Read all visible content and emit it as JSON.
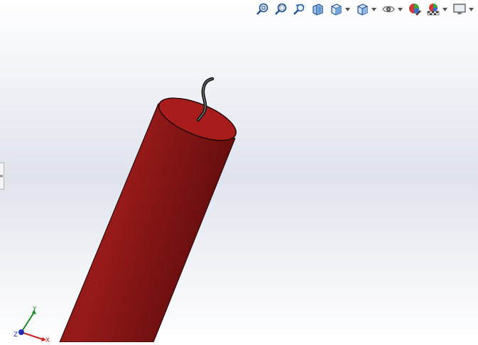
{
  "toolbar": {
    "buttons": [
      {
        "name": "zoom-to-fit",
        "icon": "zoom-fit-icon",
        "has_dropdown": false
      },
      {
        "name": "zoom-to-area",
        "icon": "zoom-area-icon",
        "has_dropdown": false
      },
      {
        "name": "previous-view",
        "icon": "previous-view-icon",
        "has_dropdown": false
      },
      {
        "name": "section-view",
        "icon": "section-view-icon",
        "has_dropdown": false
      },
      {
        "name": "view-orientation",
        "icon": "view-orientation-icon",
        "has_dropdown": true
      },
      {
        "name": "display-style",
        "icon": "display-style-icon",
        "has_dropdown": true
      },
      {
        "name": "hide-show-items",
        "icon": "eye-icon",
        "has_dropdown": true
      },
      {
        "name": "edit-appearance",
        "icon": "appearance-icon",
        "has_dropdown": false
      },
      {
        "name": "apply-scene",
        "icon": "scene-icon",
        "has_dropdown": true
      },
      {
        "name": "view-settings",
        "icon": "monitor-icon",
        "has_dropdown": true
      }
    ]
  },
  "model": {
    "body_color": "#8e1616",
    "body_shade_color": "#6a0f0f",
    "cap_color": "#b01c1c",
    "fuse_color": "#2b2b2b"
  },
  "triad": {
    "x_label": "X",
    "y_label": "Y",
    "z_label": "Z",
    "x_color": "#cc2020",
    "y_color": "#1c8a2a",
    "z_color": "#2030b0"
  }
}
